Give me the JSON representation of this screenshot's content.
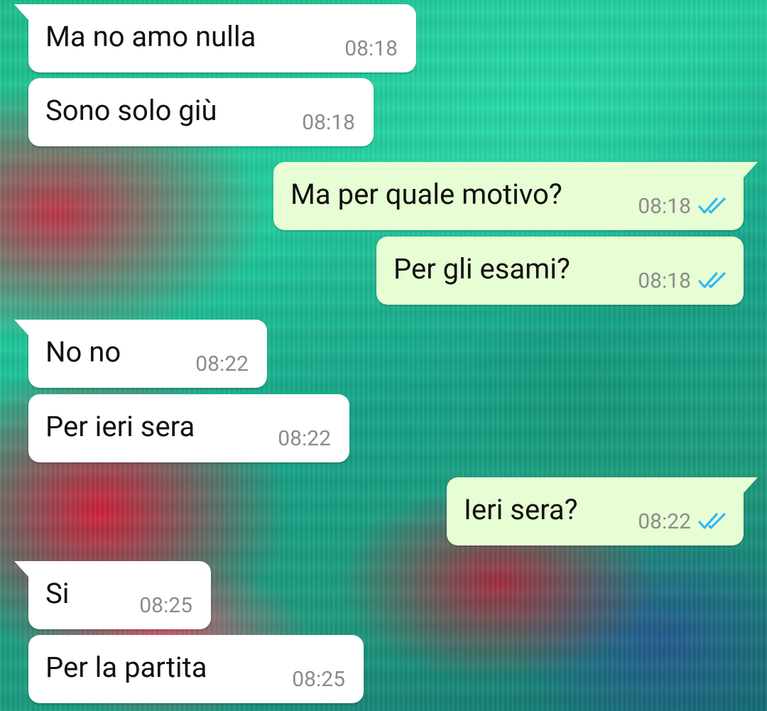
{
  "chat": {
    "tick_color": "#34b7f1",
    "messages": [
      {
        "direction": "incoming",
        "text": "Ma no amo nulla",
        "time": "08:18",
        "tail": true
      },
      {
        "direction": "incoming",
        "text": "Sono solo giù",
        "time": "08:18",
        "tail": false
      },
      {
        "direction": "outgoing",
        "text": "Ma per quale motivo?",
        "time": "08:18",
        "tail": true,
        "status": "read",
        "status_icon": "double-check-icon"
      },
      {
        "direction": "outgoing",
        "text": "Per gli esami?",
        "time": "08:18",
        "tail": false,
        "status": "read",
        "status_icon": "double-check-icon"
      },
      {
        "direction": "incoming",
        "text": "No no",
        "time": "08:22",
        "tail": true
      },
      {
        "direction": "incoming",
        "text": "Per ieri sera",
        "time": "08:22",
        "tail": false
      },
      {
        "direction": "outgoing",
        "text": "Ieri sera?",
        "time": "08:22",
        "tail": true,
        "status": "read",
        "status_icon": "double-check-icon"
      },
      {
        "direction": "incoming",
        "text": "Si",
        "time": "08:25",
        "tail": true
      },
      {
        "direction": "incoming",
        "text": "Per la partita",
        "time": "08:25",
        "tail": false
      }
    ]
  }
}
